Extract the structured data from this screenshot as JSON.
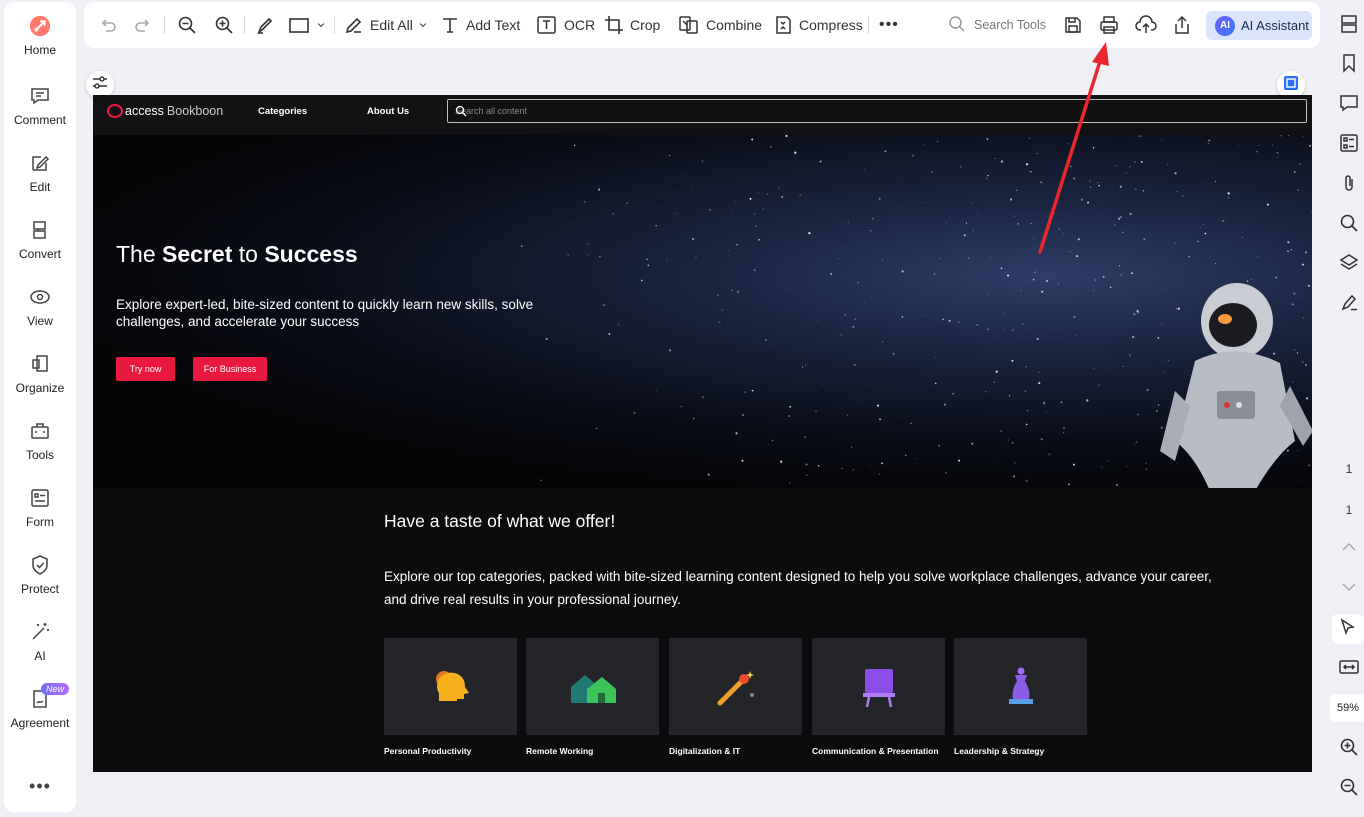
{
  "left_sidebar": {
    "items": [
      {
        "label": "Home",
        "icon": "home-rocket-icon"
      },
      {
        "label": "Comment",
        "icon": "comment-icon"
      },
      {
        "label": "Edit",
        "icon": "edit-icon"
      },
      {
        "label": "Convert",
        "icon": "convert-icon"
      },
      {
        "label": "View",
        "icon": "view-icon"
      },
      {
        "label": "Organize",
        "icon": "organize-icon"
      },
      {
        "label": "Tools",
        "icon": "tools-icon"
      },
      {
        "label": "Form",
        "icon": "form-icon"
      },
      {
        "label": "Protect",
        "icon": "protect-icon"
      },
      {
        "label": "AI",
        "icon": "ai-wand-icon"
      },
      {
        "label": "Agreement",
        "icon": "agreement-icon"
      }
    ],
    "new_badge": "New",
    "more": "•••"
  },
  "toolbar": {
    "edit_all": "Edit All",
    "add_text": "Add Text",
    "ocr": "OCR",
    "crop": "Crop",
    "combine": "Combine",
    "compress": "Compress",
    "more": "•••",
    "search_tools": "Search Tools",
    "ai_assistant": "AI Assistant",
    "ai_logo": "AI"
  },
  "right_sidebar": {
    "page_current": "1",
    "page_total": "1",
    "zoom": "59%"
  },
  "document": {
    "logo_access": "access",
    "logo_bookboon": "Bookboon",
    "nav_categories": "Categories",
    "nav_about": "About Us",
    "search_placeholder": "Search all content",
    "hero_title_pre": "The ",
    "hero_title_bold1": "Secret",
    "hero_title_mid": " to ",
    "hero_title_bold2": "Success",
    "hero_subtitle": "Explore expert-led, bite-sized content to quickly learn new skills, solve challenges, and accelerate your success",
    "btn_try": "Try now",
    "btn_business": "For Business",
    "offer_title": "Have a taste of what we offer!",
    "offer_subtitle": "Explore our top categories, packed with bite-sized learning content designed to help you solve workplace challenges, advance your career, and drive real results in your professional journey.",
    "categories": [
      {
        "label": "Personal Productivity",
        "icon": "head-gear-icon"
      },
      {
        "label": "Remote Working",
        "icon": "houses-icon"
      },
      {
        "label": "Digitalization & IT",
        "icon": "magic-wand-icon"
      },
      {
        "label": "Communication & Presentation",
        "icon": "presentation-board-icon"
      },
      {
        "label": "Leadership & Strategy",
        "icon": "chess-queen-icon"
      }
    ]
  },
  "colors": {
    "accent_red": "#e8183e",
    "annotation_arrow": "#e8272e",
    "ai_button_bg": "#dbe4fb"
  }
}
